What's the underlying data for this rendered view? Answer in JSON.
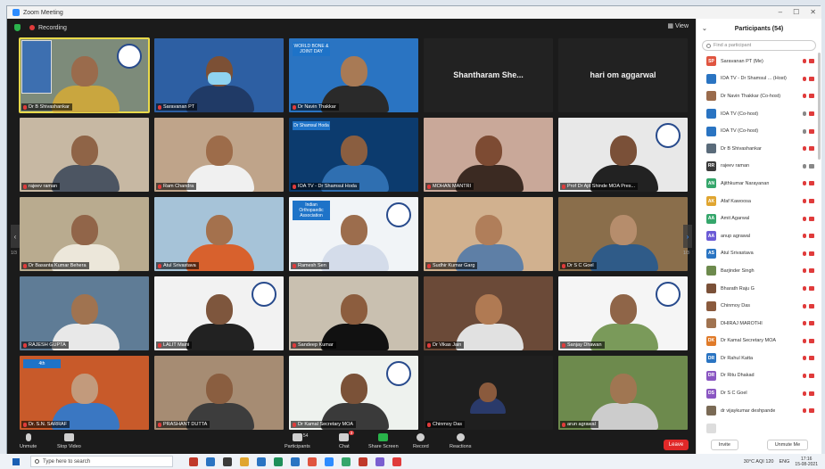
{
  "window": {
    "title": "Zoom Meeting",
    "controls": [
      "–",
      "☐",
      "✕"
    ]
  },
  "meeting": {
    "recording_label": "Recording",
    "view_label": "View"
  },
  "tiles": [
    {
      "name": "Dr B Shivashankar",
      "bg": "#7d8b7a",
      "skin": "#9a6b4c",
      "shirt": "#c9a63f",
      "active": true,
      "logo": true,
      "left_photo": true
    },
    {
      "name": "Saravanan PT",
      "bg": "#2d5fa3",
      "skin": "#7c5035",
      "shirt": "#203a66",
      "mask": true
    },
    {
      "name": "Dr Navin Thakkar",
      "bg": "#2a74c2",
      "skin": "#a87a55",
      "shirt": "#2a2a2a",
      "banner": "WORLD BONE & JOINT DAY"
    },
    {
      "name": "Shantharam She...",
      "bg": "#222222",
      "text_only": true
    },
    {
      "name": "hari om aggarwal",
      "bg": "#222222",
      "text_only": true
    },
    {
      "name": "rajeev raman",
      "bg": "#c7b8a3",
      "skin": "#8f6447",
      "shirt": "#4c5562"
    },
    {
      "name": "Ram Chandra",
      "bg": "#bfa48a",
      "skin": "#9d6c4a",
      "shirt": "#f0f0f0"
    },
    {
      "name": "IOA TV - Dr Shamsul Hoda",
      "bg": "#0c3b6e",
      "skin": "#8a5e40",
      "shirt": "#2f6fb1",
      "banner": "Dr Shamsul Hoda"
    },
    {
      "name": "MOHAN MANTRI",
      "bg": "#c9a899",
      "skin": "#7d4b33",
      "shirt": "#3b2a22"
    },
    {
      "name": "Prof Dr Ajit Shinde MOA Pres...",
      "bg": "#e8e8e8",
      "skin": "#7a5038",
      "shirt": "#222222",
      "logo": true
    },
    {
      "name": "Dr Basanta Kumar Behera",
      "bg": "#b9ab8f",
      "skin": "#916549",
      "shirt": "#ece7da"
    },
    {
      "name": "Atul Srivastava",
      "bg": "#a6c3d8",
      "skin": "#a4714d",
      "shirt": "#d8612d"
    },
    {
      "name": "Ramesh Sen",
      "bg": "#f1f4f7",
      "skin": "#9c6d4d",
      "shirt": "#d4dcea",
      "logo": true,
      "banner": "Indian Orthopaedic Association"
    },
    {
      "name": "Sudhir Kumar Garg",
      "bg": "#d1b18f",
      "skin": "#b07e5a",
      "shirt": "#5e7fa6"
    },
    {
      "name": "Dr S C Goel",
      "bg": "#8a6e4b",
      "skin": "#b68d6c",
      "shirt": "#2f5b88"
    },
    {
      "name": "RAJESH GUPTA",
      "bg": "#5f7c96",
      "skin": "#a07350",
      "shirt": "#e8e8e8"
    },
    {
      "name": "LALIT Maini",
      "bg": "#f2f2f2",
      "skin": "#7e563d",
      "shirt": "#222222",
      "logo": true
    },
    {
      "name": "Sandeep Kumar",
      "bg": "#c9c0b0",
      "skin": "#8c5d3e",
      "shirt": "#111111"
    },
    {
      "name": "Dr Vikas Jain",
      "bg": "#6b4a38",
      "skin": "#b07a53",
      "shirt": "#e1e1e1"
    },
    {
      "name": "Sanjay Dhawan",
      "bg": "#f5f5f5",
      "skin": "#8f6548",
      "shirt": "#7a9a5a",
      "logo": true
    },
    {
      "name": "Dr. S.N. SARRAF",
      "bg": "#c85a2a",
      "skin": "#c29a7c",
      "shirt": "#3a77c2",
      "banner": "4th"
    },
    {
      "name": "PRASHANT DUTTA",
      "bg": "#a68c73",
      "skin": "#8a5e40",
      "shirt": "#3d3d3d"
    },
    {
      "name": "Dr Kamal Secretary MOA",
      "bg": "#eef2ee",
      "skin": "#7b5238",
      "shirt": "#3a3a3a",
      "logo": true
    },
    {
      "name": "Chinmoy Das",
      "bg": "#1f1f1f",
      "skin": "#8a5a3d",
      "shirt": "#2a3a6a",
      "small_photo": true
    },
    {
      "name": "arun agrawal",
      "bg": "#6d8a4d",
      "skin": "#a07652",
      "shirt": "#cccccc"
    }
  ],
  "pager": {
    "left": "‹",
    "right": "›",
    "left_num": "1/3",
    "right_num": "1/3"
  },
  "toolbar": {
    "unmute": "Unmute",
    "stop_video": "Stop Video",
    "participants": "Participants",
    "participants_count": "54",
    "chat": "Chat",
    "chat_badge": "3",
    "share_screen": "Share Screen",
    "record": "Record",
    "reactions": "Reactions",
    "leave": "Leave"
  },
  "panel": {
    "title": "Participants (54)",
    "search_placeholder": "Find a participant",
    "invite": "Invite",
    "unmute_me": "Unmute Me",
    "participants": [
      {
        "initials": "SP",
        "name": "Saravanan PT (Me)",
        "color": "#e05540",
        "mic": false,
        "cam": false
      },
      {
        "initials": "",
        "name": "IOA TV - Dr Shamsul ... (Host)",
        "color": "#2a74c2",
        "mic": false,
        "cam": false
      },
      {
        "initials": "",
        "name": "Dr Navin Thakkar (Co-host)",
        "color": "#9a6b4c",
        "mic": false,
        "cam": false
      },
      {
        "initials": "",
        "name": "IOA TV (Co-host)",
        "color": "#2a74c2",
        "mic": true,
        "cam": false
      },
      {
        "initials": "",
        "name": "IOA TV (Co-host)",
        "color": "#2a74c2",
        "mic": true,
        "cam": false
      },
      {
        "initials": "",
        "name": "Dr B Shivashankar",
        "color": "#5a6b7a",
        "mic": false,
        "cam": false
      },
      {
        "initials": "RR",
        "name": "rajeev raman",
        "color": "#3b3b3b",
        "mic": true,
        "cam": true
      },
      {
        "initials": "AN",
        "name": "Ajithkumar Narayanan",
        "color": "#35a66b",
        "mic": false,
        "cam": false
      },
      {
        "initials": "AK",
        "name": "Afaf Kawoosa",
        "color": "#e0a530",
        "mic": false,
        "cam": false
      },
      {
        "initials": "AA",
        "name": "Amit Agarwal",
        "color": "#35a66b",
        "mic": false,
        "cam": false
      },
      {
        "initials": "AA",
        "name": "anup agrawal",
        "color": "#6b5bd6",
        "mic": false,
        "cam": false
      },
      {
        "initials": "AS",
        "name": "Atul Srivastava",
        "color": "#2a74c2",
        "mic": false,
        "cam": false
      },
      {
        "initials": "",
        "name": "Barjinder Singh",
        "color": "#6d8a4d",
        "mic": false,
        "cam": false
      },
      {
        "initials": "",
        "name": "Bharath Raju G",
        "color": "#7a5038",
        "mic": false,
        "cam": false
      },
      {
        "initials": "",
        "name": "Chinmoy Das",
        "color": "#8a5a3d",
        "mic": false,
        "cam": false
      },
      {
        "initials": "",
        "name": "DHIRAJ MAROTHI",
        "color": "#a07350",
        "mic": false,
        "cam": false
      },
      {
        "initials": "DK",
        "name": "Dr Kamal Secretary MOA",
        "color": "#e07b2a",
        "mic": false,
        "cam": false
      },
      {
        "initials": "DR",
        "name": "Dr Rahul Katta",
        "color": "#2a74c2",
        "mic": false,
        "cam": false
      },
      {
        "initials": "DR",
        "name": "Dr Ritu Dhakad",
        "color": "#8a56c2",
        "mic": false,
        "cam": false
      },
      {
        "initials": "DS",
        "name": "Dr S C Goel",
        "color": "#8a56c2",
        "mic": false,
        "cam": false
      },
      {
        "initials": "",
        "name": "dr vijaykumar deshpande",
        "color": "#7a6a55",
        "mic": false,
        "cam": false
      },
      {
        "initials": "",
        "name": "",
        "color": "#dddddd",
        "mic": false,
        "cam": false
      }
    ]
  },
  "taskbar": {
    "search_placeholder": "Type here to search",
    "weather": "30°C AQI 120",
    "lang": "ENG",
    "time": "17:16",
    "date": "15-08-2021",
    "apps": [
      "#c0392b",
      "#2a74c2",
      "#3a3a3a",
      "#e0a530",
      "#2a74c2",
      "#1e8f5a",
      "#2a74c2",
      "#e05540",
      "#2d8cff",
      "#35a66b",
      "#c0392b",
      "#7a5fd0",
      "#e03b3b"
    ]
  }
}
